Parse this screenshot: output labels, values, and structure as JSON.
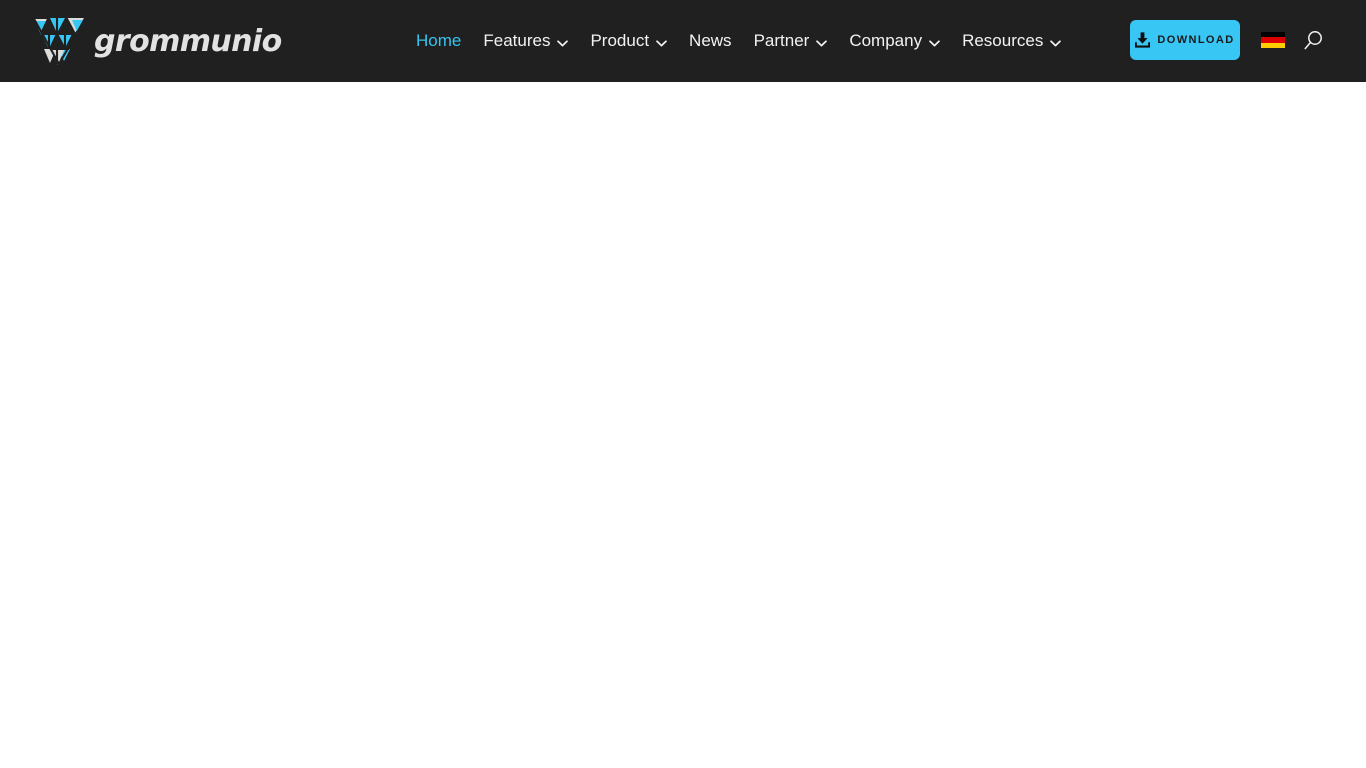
{
  "header": {
    "background_color": "#202020",
    "brand": {
      "logo_icon": "grommunio-triangle-logo",
      "wordmark": "grommunio",
      "accent_color": "#38c6f4",
      "wordmark_color": "#e2e2e2"
    },
    "nav": {
      "active_color": "#35c4f0",
      "items": [
        {
          "label": "Home",
          "has_dropdown": false,
          "active": true,
          "caret_icon": ""
        },
        {
          "label": "Features",
          "has_dropdown": true,
          "active": false,
          "caret_icon": "chevron-down-icon"
        },
        {
          "label": "Product",
          "has_dropdown": true,
          "active": false,
          "caret_icon": "chevron-down-icon"
        },
        {
          "label": "News",
          "has_dropdown": false,
          "active": false,
          "caret_icon": ""
        },
        {
          "label": "Partner",
          "has_dropdown": true,
          "active": false,
          "caret_icon": "chevron-down-icon"
        },
        {
          "label": "Company",
          "has_dropdown": true,
          "active": false,
          "caret_icon": "chevron-down-icon"
        },
        {
          "label": "Resources",
          "has_dropdown": true,
          "active": false,
          "caret_icon": "chevron-down-icon"
        }
      ]
    },
    "download_button": {
      "label": "DOWNLOAD",
      "icon": "download-icon",
      "background_color": "#38c6f4",
      "text_color": "#1a1a1a"
    },
    "language_selector": {
      "icon": "german-flag-icon",
      "country": "Germany",
      "stripe_colors": [
        "#000000",
        "#dd0000",
        "#ffce00"
      ]
    },
    "search": {
      "icon": "search-icon",
      "label": "Search"
    }
  },
  "body": {
    "background_color": "#ffffff",
    "content": ""
  }
}
